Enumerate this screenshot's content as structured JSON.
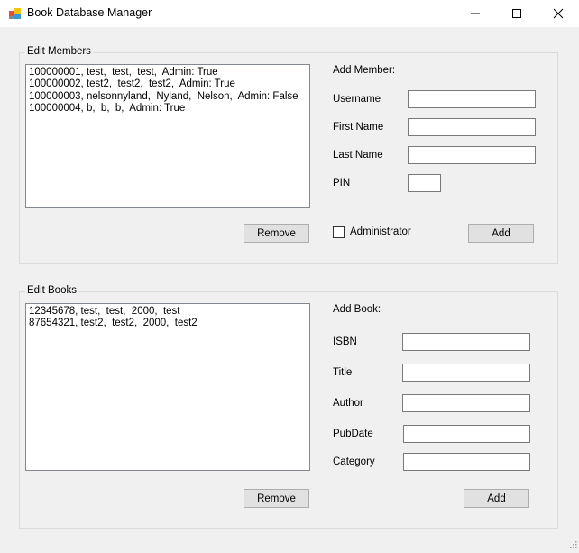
{
  "window": {
    "title": "Book Database Manager",
    "app_icon": "app-icon",
    "controls": [
      "minimize-icon",
      "maximize-icon",
      "close-icon"
    ]
  },
  "members": {
    "group_label": "Edit Members",
    "items": [
      "100000001, test,  test,  test,  Admin: True",
      "100000002, test2,  test2,  test2,  Admin: True",
      "100000003, nelsonnyland,  Nyland,  Nelson,  Admin: False",
      "100000004, b,  b,  b,  Admin: True"
    ],
    "remove_label": "Remove",
    "add_header": "Add Member:",
    "username_label": "Username",
    "username_value": "",
    "firstname_label": "First Name",
    "firstname_value": "",
    "lastname_label": "Last Name",
    "lastname_value": "",
    "pin_label": "PIN",
    "pin_value": "",
    "admin_label": "Administrator",
    "admin_checked": false,
    "add_label": "Add"
  },
  "books": {
    "group_label": "Edit Books",
    "items": [
      "12345678, test,  test,  2000,  test",
      "87654321, test2,  test2,  2000,  test2"
    ],
    "remove_label": "Remove",
    "add_header": "Add Book:",
    "isbn_label": "ISBN",
    "isbn_value": "",
    "title_label": "Title",
    "title_value": "",
    "author_label": "Author",
    "author_value": "",
    "pubdate_label": "PubDate",
    "pubdate_value": "",
    "category_label": "Category",
    "category_value": "",
    "add_label": "Add"
  }
}
